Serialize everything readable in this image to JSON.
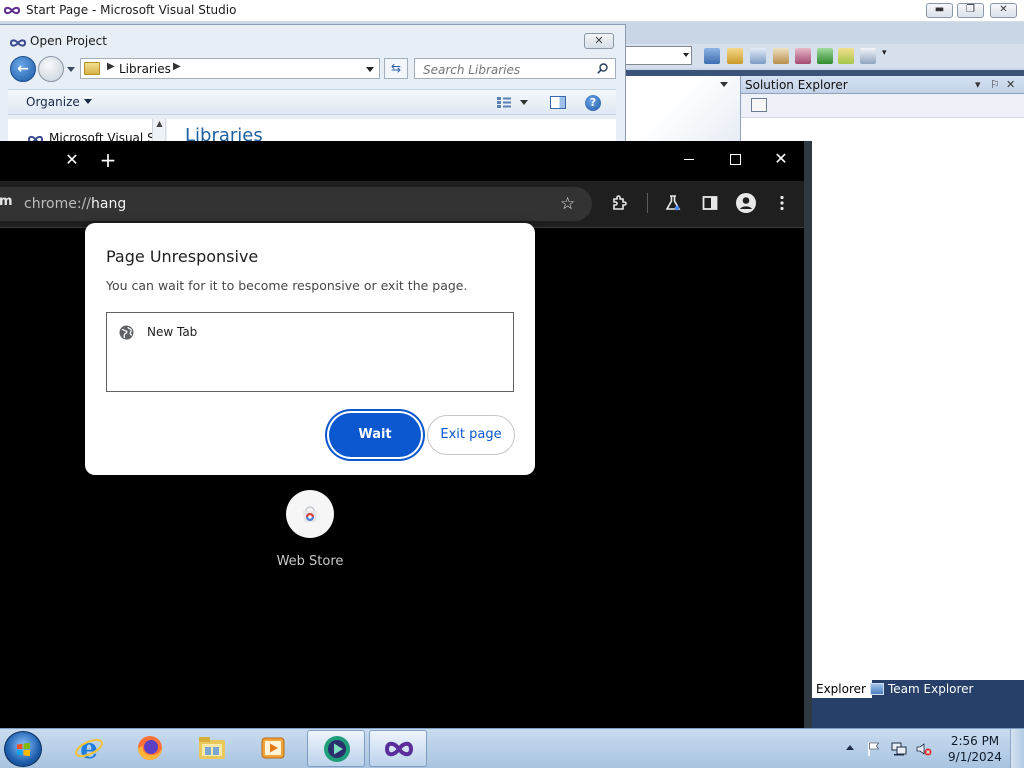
{
  "vs": {
    "title": "Start Page - Microsoft Visual Studio",
    "solution_explorer": {
      "title": "Solution Explorer",
      "tabs": [
        "Explorer",
        "Team Explorer"
      ]
    }
  },
  "open_project": {
    "title": "Open Project",
    "address": "Libraries",
    "search_placeholder": "Search Libraries",
    "organize_label": "Organize",
    "nav_item": "Microsoft Visual St",
    "content_title": "Libraries"
  },
  "chrome": {
    "omnibox_lead": "m",
    "url_scheme": "chrome://",
    "url_host": "hang",
    "page": {
      "shortcut_label": "Web Store"
    },
    "dialog": {
      "title": "Page Unresponsive",
      "message": "You can wait for it to become responsive or exit the page.",
      "items": [
        "New Tab"
      ],
      "wait_label": "Wait",
      "exit_label": "Exit page"
    }
  },
  "taskbar": {
    "apps": [
      "Internet Explorer",
      "Firefox",
      "Windows Explorer",
      "Media Player",
      "Chrome",
      "Visual Studio"
    ],
    "clock_time": "2:56 PM",
    "clock_date": "9/1/2024"
  },
  "colors": {
    "chrome_accent": "#0b57d0",
    "vs_tab_band": "#27406a"
  }
}
